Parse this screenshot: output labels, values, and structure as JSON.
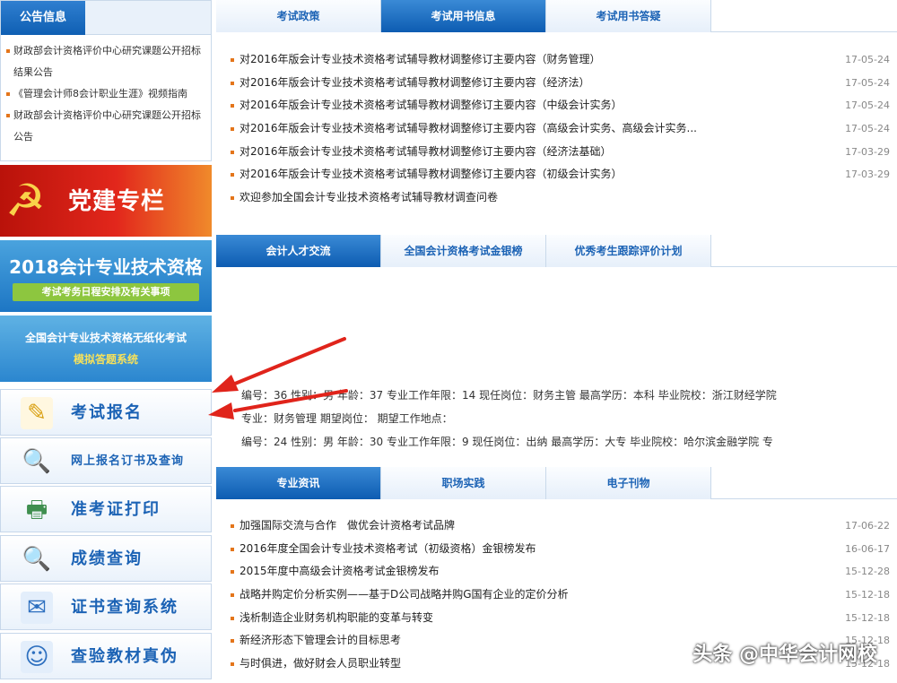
{
  "notice": {
    "tab": "公告信息",
    "items": [
      "财政部会计资格评价中心研究课题公开招标结果公告",
      "《管理会计师8会计职业生涯》视频指南",
      "财政部会计资格评价中心研究课题公开招标公告"
    ]
  },
  "banners": {
    "party": "党建专栏",
    "cpa2018_title": "2018会计专业技术资格",
    "cpa2018_sub": "考试考务日程安排及有关事项",
    "exam_title": "全国会计专业技术资格无纸化考试",
    "exam_sub": "模拟答题系统"
  },
  "services": [
    {
      "label": "考试报名",
      "icon": "document-pen-icon"
    },
    {
      "label": "网上报名订书及查询",
      "icon": "magnifier-icon"
    },
    {
      "label": "准考证打印",
      "icon": "printer-icon"
    },
    {
      "label": "成绩查询",
      "icon": "magnifier-icon"
    },
    {
      "label": "证书查询系统",
      "icon": "certificate-icon"
    },
    {
      "label": "查验教材真伪",
      "icon": "user-badge-icon"
    }
  ],
  "tabs1": [
    "考试政策",
    "考试用书信息",
    "考试用书答疑"
  ],
  "news1": [
    {
      "title": "对2016年版会计专业技术资格考试辅导教材调整修订主要内容（财务管理）",
      "date": "17-05-24"
    },
    {
      "title": "对2016年版会计专业技术资格考试辅导教材调整修订主要内容（经济法）",
      "date": "17-05-24"
    },
    {
      "title": "对2016年版会计专业技术资格考试辅导教材调整修订主要内容（中级会计实务）",
      "date": "17-05-24"
    },
    {
      "title": "对2016年版会计专业技术资格考试辅导教材调整修订主要内容（高级会计实务、高级会计实务...",
      "date": "17-05-24"
    },
    {
      "title": "对2016年版会计专业技术资格考试辅导教材调整修订主要内容（经济法基础）",
      "date": "17-03-29"
    },
    {
      "title": "对2016年版会计专业技术资格考试辅导教材调整修订主要内容（初级会计实务）",
      "date": "17-03-29"
    },
    {
      "title": "欢迎参加全国会计专业技术资格考试辅导教材调查问卷",
      "date": ""
    }
  ],
  "tabs2": [
    "会计人才交流",
    "全国会计资格考试金银榜",
    "优秀考生跟踪评价计划"
  ],
  "talent": [
    "编号：36 性别：男 年龄：37 专业工作年限：14 现任岗位：财务主管 最高学历：本科 毕业院校：浙江财经学院",
    "专业：财务管理 期望岗位： 期望工作地点：",
    "编号：24 性别：男 年龄：30 专业工作年限：9 现任岗位：出纳 最高学历：大专 毕业院校：哈尔滨金融学院 专"
  ],
  "tabs3": [
    "专业资讯",
    "职场实践",
    "电子刊物"
  ],
  "news3": [
    {
      "title": "加强国际交流与合作　做优会计资格考试品牌",
      "date": "17-06-22"
    },
    {
      "title": "2016年度全国会计专业技术资格考试（初级资格）金银榜发布",
      "date": "16-06-17"
    },
    {
      "title": "2015年度中高级会计资格考试金银榜发布",
      "date": "15-12-28"
    },
    {
      "title": "战略并购定价分析实例——基于D公司战略并购G国有企业的定价分析",
      "date": "15-12-18"
    },
    {
      "title": "浅析制造企业财务机构职能的变革与转变",
      "date": "15-12-18"
    },
    {
      "title": "新经济形态下管理会计的目标思考",
      "date": "15-12-18"
    },
    {
      "title": "与时俱进，做好财会人员职业转型",
      "date": "15-12-18"
    }
  ],
  "watermark": "头条 @中华会计网校",
  "colors": {
    "accent": "#1c63b5",
    "tab_active": "#0d5cb2",
    "arrow": "#e0241b",
    "bullet": "#e4751a"
  }
}
